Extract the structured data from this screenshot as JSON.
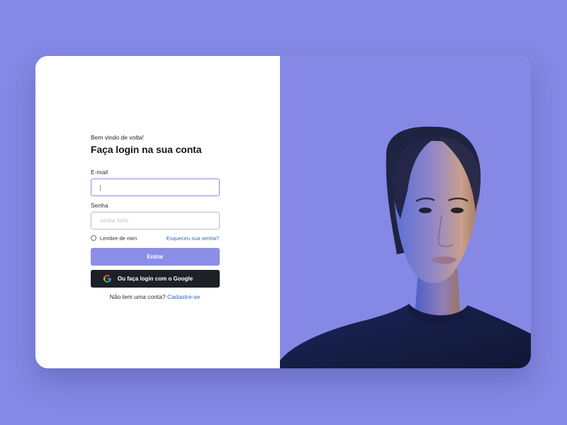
{
  "login": {
    "welcome": "Bem vindo de volta!",
    "title": "Faça login na sua conta",
    "email_label": "E-mail",
    "email_value": "",
    "password_label": "Senha",
    "password_placeholder": "senha forte",
    "remember_label": "Lembre de mim",
    "forgot_link": "Esqueceu sua senha?",
    "submit_label": "Entrar",
    "google_label": "Ou faça login com o Google",
    "signup_prompt": "Não tem uma conta?",
    "signup_link": "Cadastre-se"
  },
  "colors": {
    "background": "#8589e5",
    "accent": "#8a8ee6",
    "dark_button": "#1d2027",
    "link": "#3867b5"
  }
}
